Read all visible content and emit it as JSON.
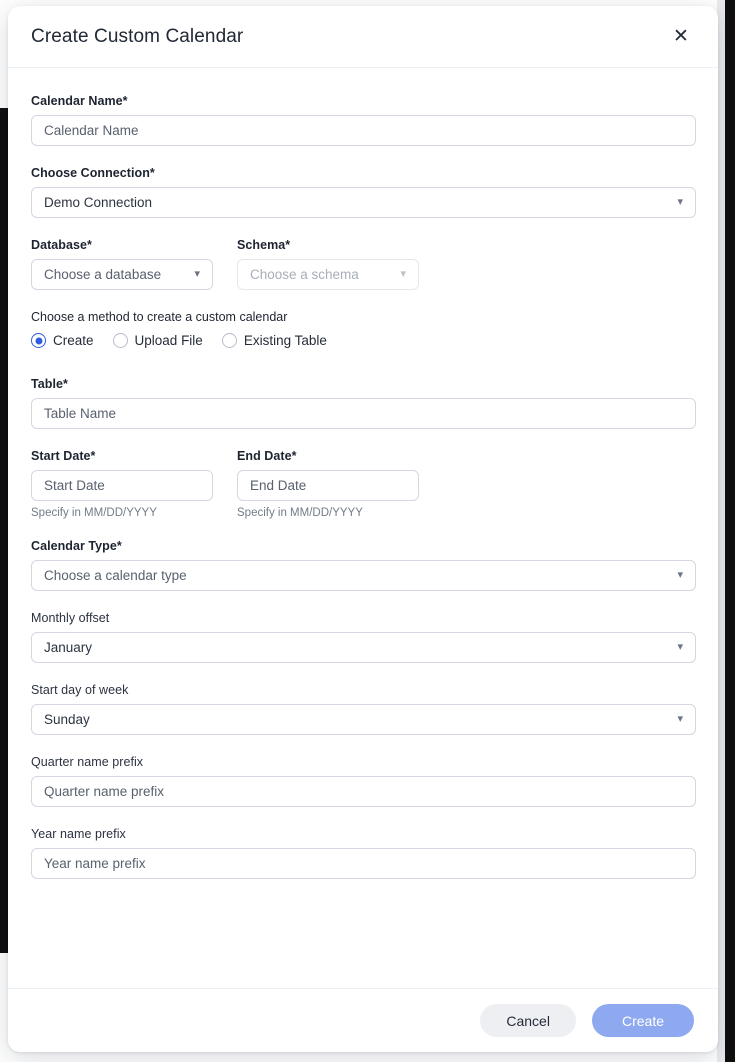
{
  "dialog": {
    "title": "Create Custom Calendar",
    "close_icon": "close-icon",
    "chevron_icon": "chevron-down-icon"
  },
  "form": {
    "calendar_name": {
      "label": "Calendar Name*",
      "placeholder": "Calendar Name",
      "value": ""
    },
    "connection": {
      "label": "Choose Connection*",
      "value": "Demo Connection"
    },
    "database": {
      "label": "Database*",
      "value": "Choose a database"
    },
    "schema": {
      "label": "Schema*",
      "value": "Choose a schema",
      "disabled": true
    },
    "method": {
      "label": "Choose a method to create a custom calendar",
      "options": [
        {
          "label": "Create",
          "selected": true
        },
        {
          "label": "Upload File",
          "selected": false
        },
        {
          "label": "Existing Table",
          "selected": false
        }
      ]
    },
    "table": {
      "label": "Table*",
      "placeholder": "Table Name",
      "value": ""
    },
    "start_date": {
      "label": "Start Date*",
      "placeholder": "Start Date",
      "value": "",
      "helper": "Specify in MM/DD/YYYY"
    },
    "end_date": {
      "label": "End Date*",
      "placeholder": "End Date",
      "value": "",
      "helper": "Specify in MM/DD/YYYY"
    },
    "calendar_type": {
      "label": "Calendar Type*",
      "value": "Choose a calendar type"
    },
    "monthly_offset": {
      "label": "Monthly offset",
      "value": "January"
    },
    "start_day_of_week": {
      "label": "Start day of week",
      "value": "Sunday"
    },
    "quarter_name_prefix": {
      "label": "Quarter name prefix",
      "placeholder": "Quarter name prefix",
      "value": ""
    },
    "year_name_prefix": {
      "label": "Year name prefix",
      "placeholder": "Year name prefix",
      "value": ""
    }
  },
  "footer": {
    "cancel_label": "Cancel",
    "create_label": "Create"
  },
  "colors": {
    "accent_blue": "#2f5de0",
    "create_button": "#8ea9f0",
    "cancel_button": "#edeff2",
    "border": "#d3d8e0",
    "title_text": "#212936"
  }
}
